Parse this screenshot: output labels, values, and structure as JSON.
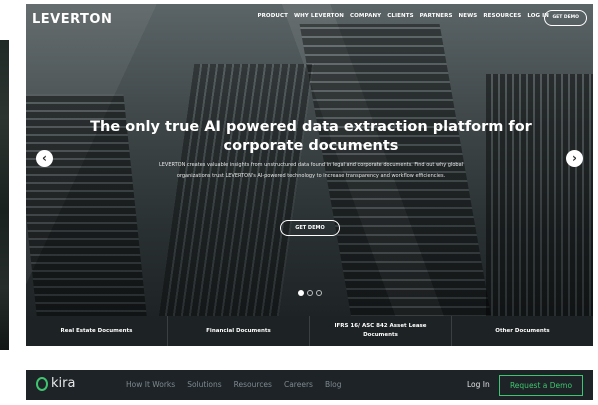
{
  "leverton": {
    "logo": "LEVERTON",
    "nav": [
      "PRODUCT",
      "WHY LEVERTON",
      "COMPANY",
      "CLIENTS",
      "PARTNERS",
      "NEWS",
      "RESOURCES",
      "LOG IN"
    ],
    "nav_cta": "GET DEMO",
    "headline": "The only true AI powered data extraction platform for corporate documents",
    "subtext": "LEVERTON creates valuable insights from unstructured data found in legal and corporate documents. Find out why global organizations trust LEVERTON's AI-powered technology to increase transparency and workflow efficiencies.",
    "hero_cta": "GET DEMO",
    "carousel_prev": "‹",
    "carousel_next": "›",
    "slide_count": 3,
    "active_slide": 1,
    "doc_tabs": [
      "Real Estate Documents",
      "Financial Documents",
      "IFRS 16/ ASC 842 Asset Lease Documents",
      "Other Documents"
    ]
  },
  "kira": {
    "logo_text": "kira",
    "nav": [
      "How It Works",
      "Solutions",
      "Resources",
      "Careers",
      "Blog"
    ],
    "login": "Log In",
    "cta": "Request a Demo",
    "accent": "#3fc56f"
  }
}
